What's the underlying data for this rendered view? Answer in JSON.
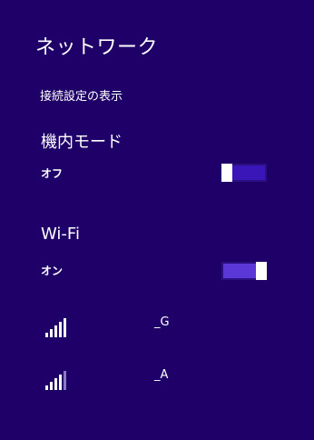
{
  "panel": {
    "title": "ネットワーク",
    "connection_settings_link": "接続設定の表示"
  },
  "airplane_mode": {
    "heading": "機内モード",
    "state_label": "オフ",
    "enabled": false
  },
  "wifi": {
    "heading": "Wi-Fi",
    "state_label": "オン",
    "enabled": true
  },
  "networks": [
    {
      "ssid": "_G",
      "signal_bars": 5,
      "icon": "wifi-signal-icon"
    },
    {
      "ssid": "_A",
      "signal_bars": 4,
      "icon": "wifi-signal-icon"
    }
  ],
  "colors": {
    "background": "#1f0068",
    "toggle_on": "#5b37d8",
    "toggle_off": "#3a16b8"
  }
}
